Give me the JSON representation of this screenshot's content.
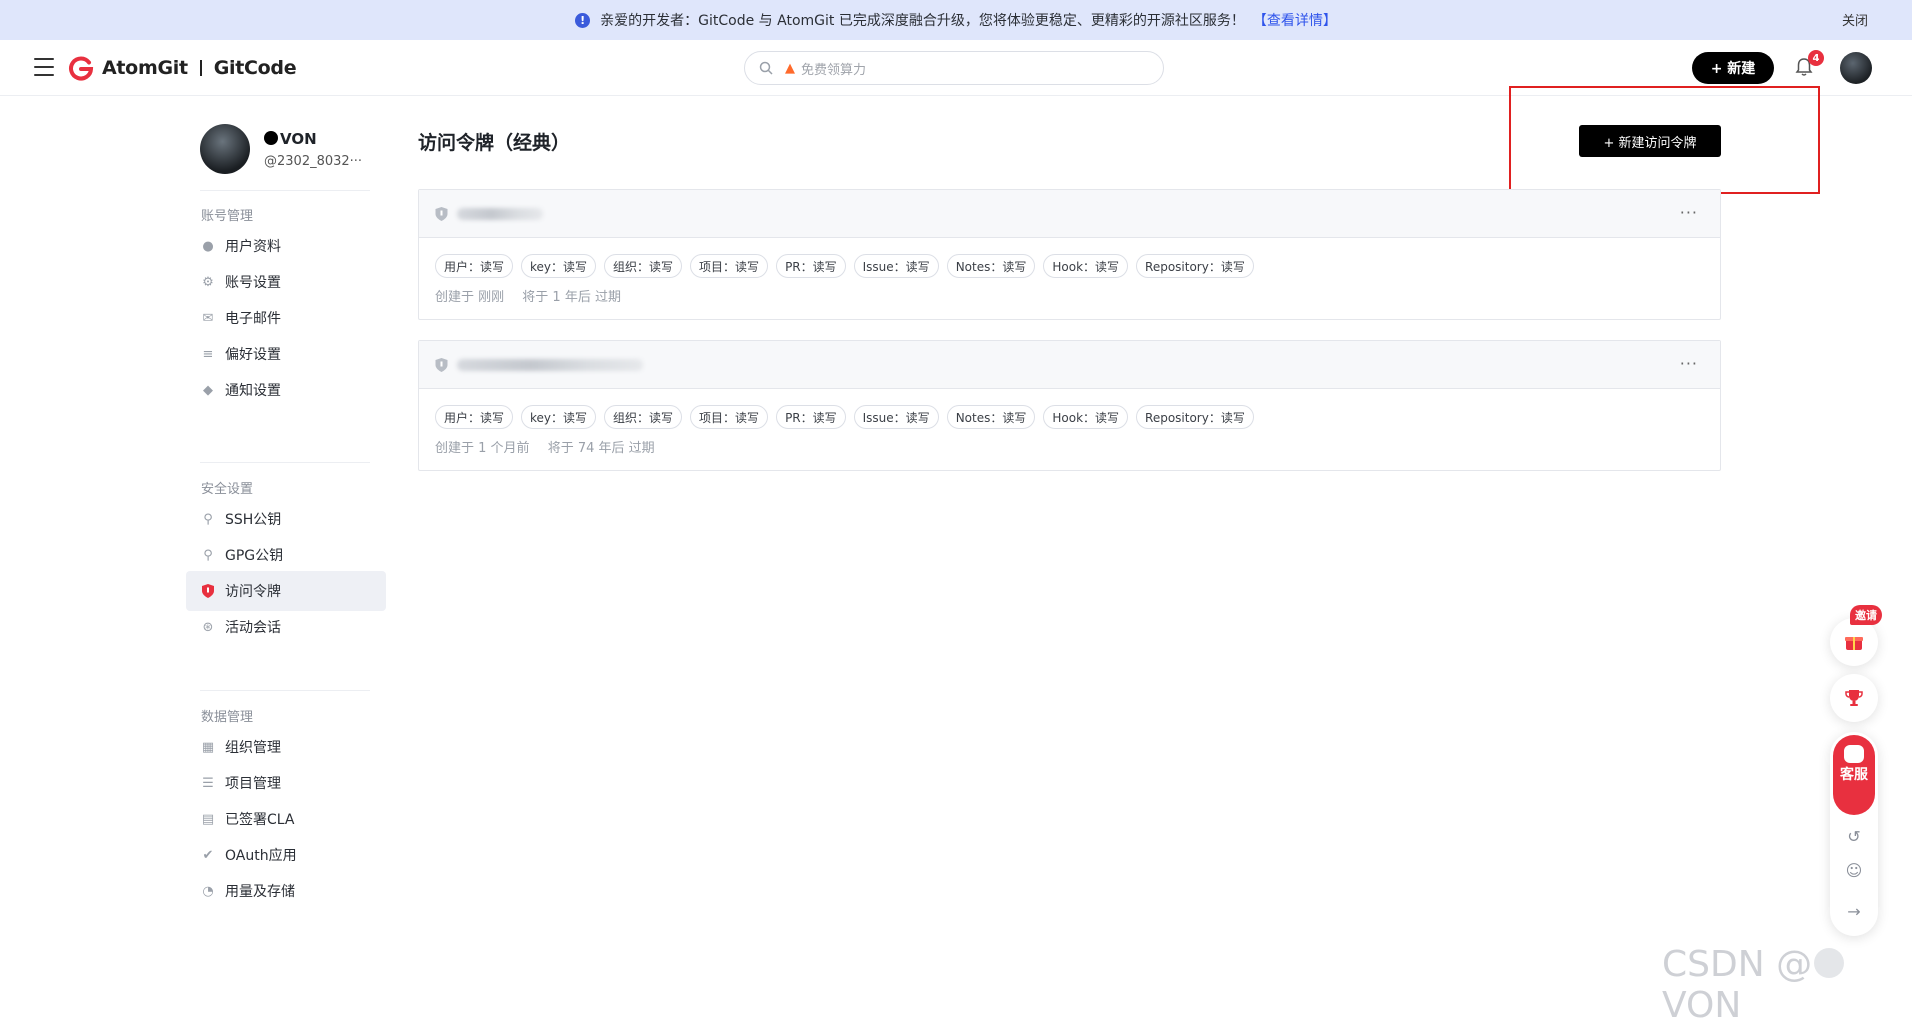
{
  "announcement": {
    "text": "亲爱的开发者：GitCode 与 AtomGit 已完成深度融合升级，您将体验更稳定、更精彩的开源社区服务！",
    "link": "【查看详情】",
    "close": "关闭"
  },
  "header": {
    "logo_left": "AtomGit",
    "logo_right": "GitCode",
    "search_placeholder": "免费领算力",
    "new_button": "+ 新建",
    "notification_count": "4"
  },
  "profile": {
    "name": "VON",
    "handle": "@2302_8032···"
  },
  "sidebar": {
    "groups": [
      {
        "title": "账号管理",
        "items": [
          {
            "label": "用户资料",
            "icon": "user-icon"
          },
          {
            "label": "账号设置",
            "icon": "gear-icon"
          },
          {
            "label": "电子邮件",
            "icon": "mail-icon"
          },
          {
            "label": "偏好设置",
            "icon": "sliders-icon"
          },
          {
            "label": "通知设置",
            "icon": "notification-icon"
          }
        ]
      },
      {
        "title": "安全设置",
        "items": [
          {
            "label": "SSH公钥",
            "icon": "key-icon"
          },
          {
            "label": "GPG公钥",
            "icon": "key-icon"
          },
          {
            "label": "访问令牌",
            "icon": "shield-icon",
            "active": true
          },
          {
            "label": "活动会话",
            "icon": "signal-icon"
          }
        ]
      },
      {
        "title": "数据管理",
        "items": [
          {
            "label": "组织管理",
            "icon": "building-icon"
          },
          {
            "label": "项目管理",
            "icon": "layers-icon"
          },
          {
            "label": "已签署CLA",
            "icon": "document-icon"
          },
          {
            "label": "OAuth应用",
            "icon": "shield-check-icon"
          },
          {
            "label": "用量及存储",
            "icon": "pie-chart-icon"
          }
        ]
      }
    ]
  },
  "main": {
    "title": "访问令牌（经典）",
    "create_button": "+ 新建访问令牌",
    "tokens": [
      {
        "scopes": [
          "用户：读写",
          "key：读写",
          "组织：读写",
          "项目：读写",
          "PR：读写",
          "Issue：读写",
          "Notes：读写",
          "Hook：读写",
          "Repository：读写"
        ],
        "created": "创建于 刚刚",
        "expires": "将于 1 年后 过期"
      },
      {
        "scopes": [
          "用户：读写",
          "key：读写",
          "组织：读写",
          "项目：读写",
          "PR：读写",
          "Issue：读写",
          "Notes：读写",
          "Hook：读写",
          "Repository：读写"
        ],
        "created": "创建于 1 个月前",
        "expires": "将于 74 年后 过期"
      }
    ],
    "more_label": "···"
  },
  "floating": {
    "invite": "邀请",
    "service": "客服"
  },
  "watermark": {
    "left": "CSDN @",
    "right": "VON"
  },
  "colors": {
    "accent": "#e8303f",
    "announce_bg": "#dfe6fb",
    "link": "#2f54eb",
    "highlight": "#e02020"
  }
}
